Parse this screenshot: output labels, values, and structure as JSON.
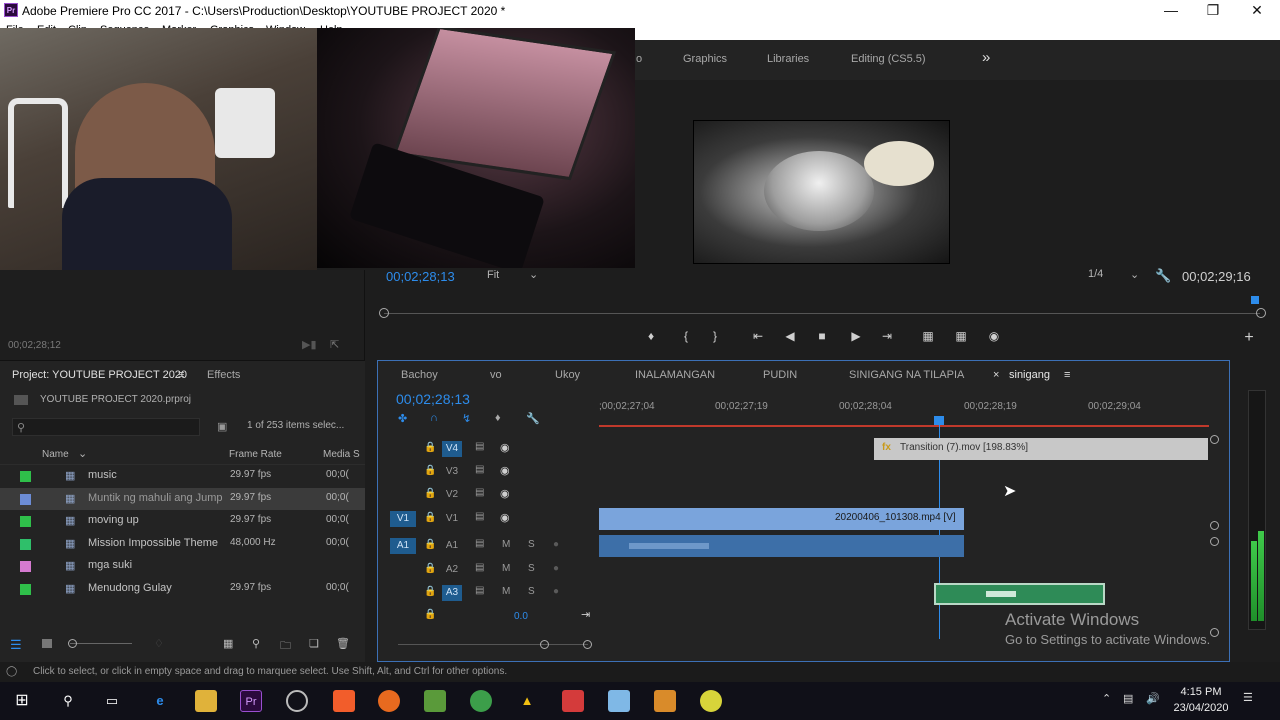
{
  "window": {
    "title": "Adobe Premiere Pro CC 2017 - C:\\Users\\Production\\Desktop\\YOUTUBE PROJECT 2020 *",
    "app_icon": "Pr"
  },
  "menu": [
    "File",
    "Edit",
    "Clip",
    "Sequence",
    "Marker",
    "Graphics",
    "Window",
    "Help"
  ],
  "workspaces": {
    "partial": "o",
    "items": [
      "Graphics",
      "Libraries",
      "Editing (CS5.5)"
    ],
    "more": "»"
  },
  "source": {
    "timecode": "00;02;28;12"
  },
  "program": {
    "timecode": "00;02;28;13",
    "fit": "Fit",
    "resolution": "1/4",
    "duration": "00;02;29;16"
  },
  "project": {
    "tab_project": "Project: YOUTUBE PROJECT 2020",
    "tab_effects": "Effects",
    "file": "YOUTUBE PROJECT 2020.prproj",
    "count": "1 of 253 items selec...",
    "columns": {
      "name": "Name",
      "rate": "Frame Rate",
      "media": "Media S"
    },
    "items": [
      {
        "name": "music",
        "rate": "29.97 fps",
        "media": "00;0(",
        "color": "#2fbf4a"
      },
      {
        "name": "Muntik ng mahuli ang Jump",
        "rate": "29.97 fps",
        "media": "00;0(",
        "color": "#6c8cd5"
      },
      {
        "name": "moving up",
        "rate": "29.97 fps",
        "media": "00;0(",
        "color": "#2fbf4a"
      },
      {
        "name": "Mission Impossible Theme",
        "rate": "48,000 Hz",
        "media": "00;0(",
        "color": "#2fbf6a"
      },
      {
        "name": "mga suki",
        "rate": "",
        "media": "",
        "color": "#d57ad0"
      },
      {
        "name": "Menudong Gulay",
        "rate": "29.97 fps",
        "media": "00;0(",
        "color": "#2fbf4a"
      }
    ]
  },
  "timeline": {
    "tabs": [
      "Bachoy",
      "vo",
      "Ukoy",
      "INALAMANGAN",
      "PUDIN",
      "SINIGANG NA TILAPIA",
      "sinigang"
    ],
    "close": "×",
    "timecode": "00;02;28;13",
    "ruler": [
      ";00;02;27;04",
      "00;02;27;19",
      "00;02;28;04",
      "00;02;28;19",
      "00;02;29;04"
    ],
    "tracks_video": [
      "V4",
      "V3",
      "V2",
      "V1"
    ],
    "tracks_audio": [
      "A1",
      "A2",
      "A3"
    ],
    "src_v": "V1",
    "src_a": "A1",
    "mute": "M",
    "solo": "S",
    "vol": "0.0",
    "clip_v4": "Transition (7).mov [198.83%]",
    "clip_v1": "20200406_101308.mp4 [V]",
    "fx": "fx"
  },
  "status": "Click to select, or click in empty space and drag to marquee select. Use Shift, Alt, and Ctrl for other options.",
  "watermark": {
    "title": "Activate Windows",
    "sub": "Go to Settings to activate Windows."
  },
  "taskbar": {
    "time": "4:15 PM",
    "date": "23/04/2020"
  }
}
